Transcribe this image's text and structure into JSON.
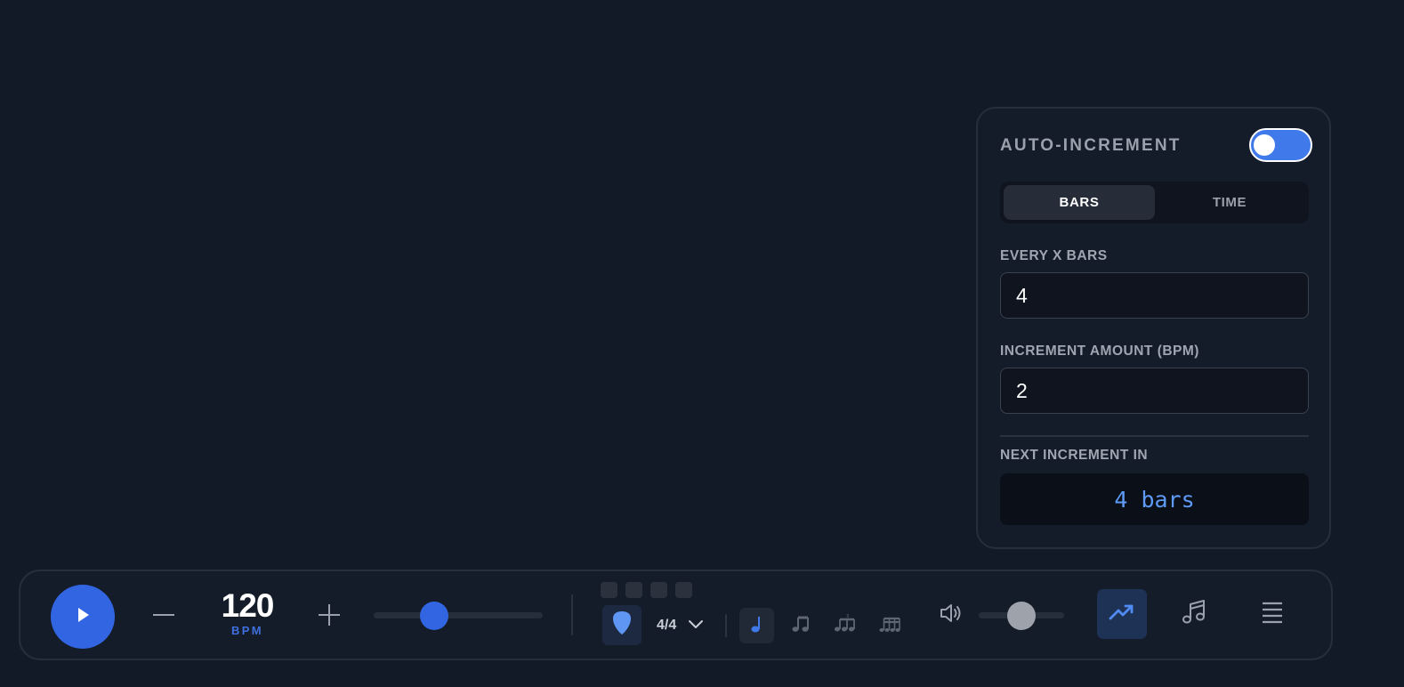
{
  "auto_increment": {
    "title": "AUTO-INCREMENT",
    "enabled": true,
    "modes": [
      {
        "label": "BARS",
        "active": true
      },
      {
        "label": "TIME",
        "active": false
      }
    ],
    "every_label": "EVERY X BARS",
    "every_value": "4",
    "amount_label": "INCREMENT AMOUNT (BPM)",
    "amount_value": "2",
    "next_label": "NEXT INCREMENT IN",
    "next_value": "4 bars"
  },
  "transport": {
    "bpm": "120",
    "bpm_unit": "BPM",
    "tempo_slider_fraction": 0.36,
    "beats": 4,
    "time_signature": "4/4",
    "subdivisions": [
      {
        "icon": "quarter-note-icon",
        "active": true
      },
      {
        "icon": "eighth-notes-icon",
        "active": false
      },
      {
        "icon": "triplet-icon",
        "active": false
      },
      {
        "icon": "sixteenth-notes-icon",
        "active": false
      }
    ],
    "volume_fraction": 0.5
  },
  "colors": {
    "background": "#131a27",
    "panel": "#151c29",
    "accent": "#3165e2",
    "toggle_on": "#3f79ea",
    "readout_text": "#5e9bf6",
    "muted_text": "#9aa1ac"
  }
}
